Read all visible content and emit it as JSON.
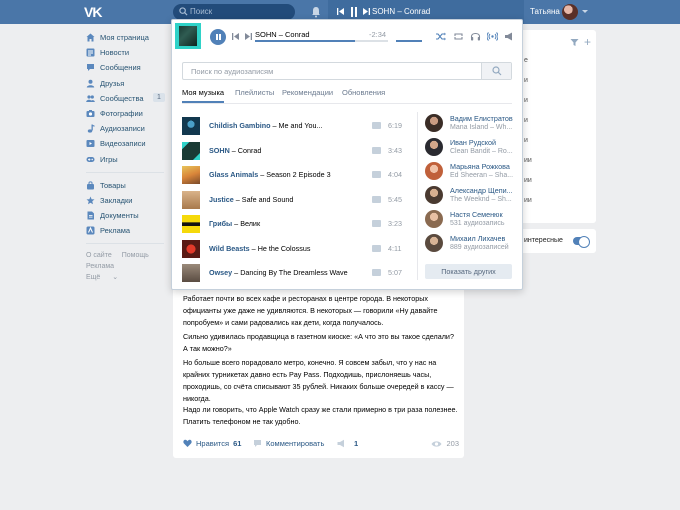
{
  "header": {
    "logo": "VK",
    "search_placeholder": "Поиск",
    "player_title": "SOHN – Conrad",
    "user_name": "Татьяна"
  },
  "sidebar": {
    "items": [
      {
        "label": "Моя страница",
        "icon": "home-icon"
      },
      {
        "label": "Новости",
        "icon": "news-icon"
      },
      {
        "label": "Сообщения",
        "icon": "messages-icon"
      },
      {
        "label": "Друзья",
        "icon": "friends-icon"
      },
      {
        "label": "Сообщества",
        "icon": "communities-icon",
        "badge": "1"
      },
      {
        "label": "Фотографии",
        "icon": "camera-icon"
      },
      {
        "label": "Аудиозаписи",
        "icon": "music-note-icon"
      },
      {
        "label": "Видеозаписи",
        "icon": "video-icon"
      },
      {
        "label": "Игры",
        "icon": "games-icon"
      }
    ],
    "items2": [
      {
        "label": "Товары",
        "icon": "bag-icon"
      },
      {
        "label": "Закладки",
        "icon": "star-icon"
      },
      {
        "label": "Документы",
        "icon": "document-icon"
      },
      {
        "label": "Реклама",
        "icon": "ads-icon"
      }
    ],
    "footer": {
      "about": "О сайте",
      "help": "Помощь",
      "ads": "Реклама",
      "more": "Ещё"
    }
  },
  "right_panel": {
    "lines": [
      "е",
      "и",
      "и",
      "и",
      "и",
      "ии",
      "ии",
      "ии"
    ],
    "interesting_label": "интересные"
  },
  "popup": {
    "player": {
      "title": "SOHN – Conrad",
      "time": "-2:34",
      "progress": 0.75
    },
    "search_placeholder": "Поиск по аудиозаписям",
    "tabs": [
      "Моя музыка",
      "Плейлисты",
      "Рекомендации",
      "Обновления"
    ],
    "tracks": [
      {
        "artist": "Childish Gambino",
        "title": "Me and You...",
        "duration": "6:19"
      },
      {
        "artist": "SOHN",
        "title": "Conrad",
        "duration": "3:43"
      },
      {
        "artist": "Glass Animals",
        "title": "Season 2 Episode 3",
        "duration": "4:04"
      },
      {
        "artist": "Justice",
        "title": "Safe and Sound",
        "duration": "5:45"
      },
      {
        "artist": "Грибы",
        "title": "Велик",
        "duration": "3:23"
      },
      {
        "artist": "Wild Beasts",
        "title": "He the Colossus",
        "duration": "4:11"
      },
      {
        "artist": "Owsey",
        "title": "Dancing By The Dreamless Wave",
        "duration": "5:07"
      }
    ],
    "friends": [
      {
        "name": "Вадим Елистратов",
        "sub": "Mana Island – Wh..."
      },
      {
        "name": "Иван Рудской",
        "sub": "Clean Bandit – Ro..."
      },
      {
        "name": "Марьяна Рожкова",
        "sub": "Ed Sheeran – Sha..."
      },
      {
        "name": "Александр Щепи...",
        "sub": "The Weeknd – Sh..."
      },
      {
        "name": "Настя Семенюк",
        "sub": "531 аудиозапись"
      },
      {
        "name": "Михаил Лихачев",
        "sub": "889 аудиозаписей"
      }
    ],
    "show_others": "Показать других"
  },
  "post": {
    "paragraphs": [
      "Работает почти во всех кафе и ресторанах в центре города. В некоторых официанты уже даже не удивляются. В некоторых — говорили «Ну давайте попробуем» и сами радовались как дети, когда получалось.",
      "Сильно удивилась продавщица в газетном киоске: «А что это вы такое сделали? А так можно?»",
      "Но больше всего порадовало метро, конечно. Я совсем забыл, что у нас на крайних турникетах давно есть Pay Pass. Подходишь, прислоняешь часы, проходишь, со счёта списывают 35 рублей. Никаких больше очередей в кассу — никогда.",
      "Надо ли говорить, что Apple Watch сразу же стали примерно в три раза полезнее. Платить телефоном не так удобно."
    ],
    "like_label": "Нравится",
    "like_count": "61",
    "comment_label": "Комментировать",
    "share_count": "1",
    "views": "203"
  }
}
